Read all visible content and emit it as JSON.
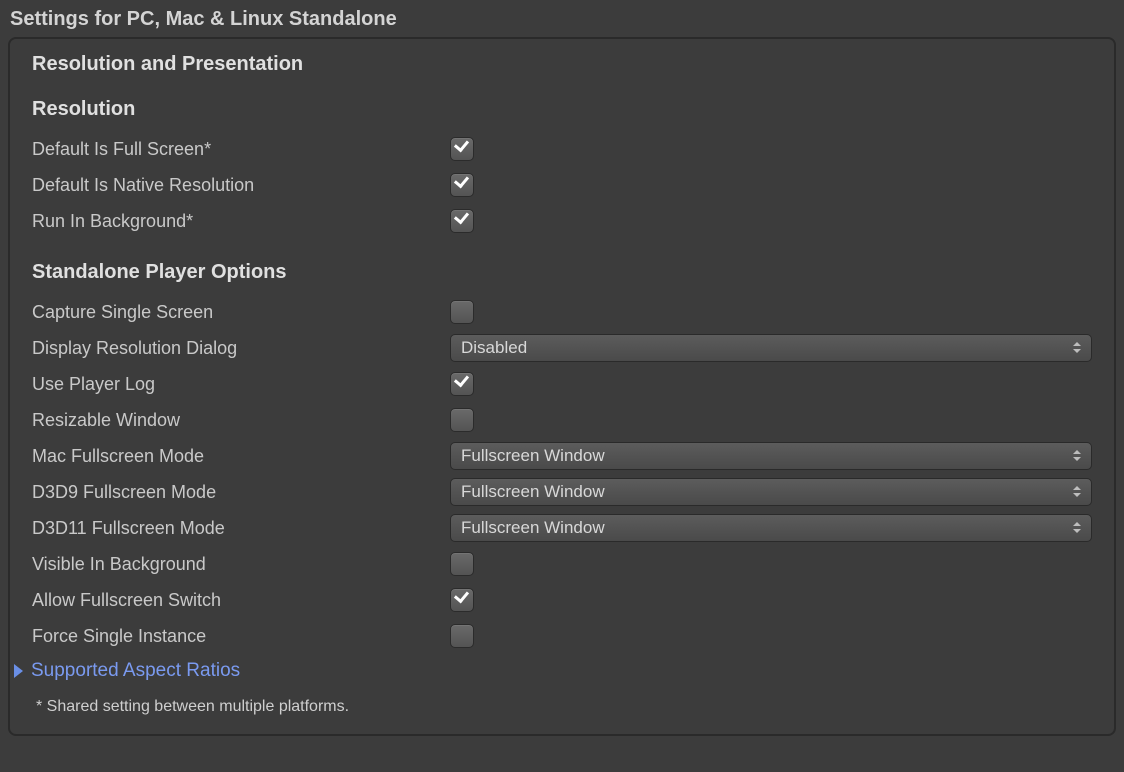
{
  "window": {
    "title": "Settings for PC, Mac & Linux Standalone"
  },
  "panel": {
    "section_title": "Resolution and Presentation",
    "footnote": "* Shared setting between multiple platforms."
  },
  "resolution": {
    "heading": "Resolution",
    "default_fullscreen": {
      "label": "Default Is Full Screen*",
      "checked": true
    },
    "default_native_res": {
      "label": "Default Is Native Resolution",
      "checked": true
    },
    "run_in_background": {
      "label": "Run In Background*",
      "checked": true
    }
  },
  "standalone": {
    "heading": "Standalone Player Options",
    "capture_single_screen": {
      "label": "Capture Single Screen",
      "checked": false
    },
    "display_res_dialog": {
      "label": "Display Resolution Dialog",
      "value": "Disabled"
    },
    "use_player_log": {
      "label": "Use Player Log",
      "checked": true
    },
    "resizable_window": {
      "label": "Resizable Window",
      "checked": false
    },
    "mac_fullscreen_mode": {
      "label": "Mac Fullscreen Mode",
      "value": "Fullscreen Window"
    },
    "d3d9_fullscreen_mode": {
      "label": "D3D9 Fullscreen Mode",
      "value": "Fullscreen Window"
    },
    "d3d11_fullscreen_mode": {
      "label": "D3D11 Fullscreen Mode",
      "value": "Fullscreen Window"
    },
    "visible_in_background": {
      "label": "Visible In Background",
      "checked": false
    },
    "allow_fullscreen_switch": {
      "label": "Allow Fullscreen Switch",
      "checked": true
    },
    "force_single_instance": {
      "label": "Force Single Instance",
      "checked": false
    },
    "supported_aspect_ratios": {
      "label": "Supported Aspect Ratios"
    }
  }
}
